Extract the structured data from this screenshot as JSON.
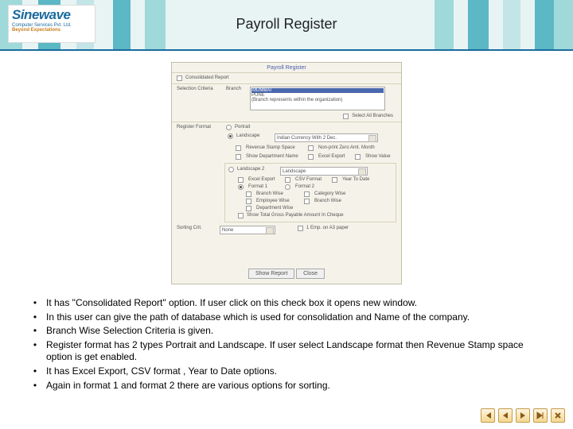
{
  "logo": {
    "name": "Sinewave",
    "line1": "Computer Services Pvt. Ltd.",
    "line2": "Beyond Expectations"
  },
  "title": "Payroll Register",
  "screenshot": {
    "heading": "Payroll Register",
    "consolidated": "Consolidated Report",
    "selection_label": "Selection Criteria",
    "branch_label": "Branch",
    "branch_sel": "MUMBAI",
    "branch_opt1": "PUNE",
    "branch_opt2": "(Branch represents within the organization)",
    "select_all": "Select All Branches",
    "register_label": "Register Format",
    "portrait": "Portrait",
    "landscape_rd": "Landscape",
    "landscape_combo": "Indian Currency With 2 Dec.",
    "revenue": "Revenue Stamp Space",
    "nonprint": "Non-print Zero Amt. Month",
    "show_dept": "Show Department Name",
    "excel_export": "Excel Export",
    "show_value": "Show Value",
    "landscape2": "Landscape 2",
    "landscape_cb": "Landscape",
    "ex_export": "Excel Export",
    "csv": "CSV Format",
    "format1": "Format 1",
    "format2": "Format 2",
    "branch_wise": "Branch Wise",
    "category": "Category Wise",
    "employee_wise": "Employee Wise",
    "branch_wise2": "Branch Wise",
    "department": "Department Wise",
    "show_total": "Show Total Gross Payable Amount In Cheque",
    "sorting_label": "Sorting Crit.",
    "sorting_value": "None",
    "one_page": "1 Emp. on A3 paper",
    "show_report": "Show Report",
    "close": "Close"
  },
  "bullets": [
    "It has \"Consolidated Report\" option. If user click on this check box it opens new window.",
    "In this user can give the path of database which is used for consolidation and Name of the company.",
    "Branch Wise Selection Criteria is given.",
    "Register format has 2 types Portrait and Landscape. If user select Landscape format then Revenue Stamp space option is get enabled.",
    "It has Excel Export, CSV format , Year to Date options.",
    "Again in format 1 and format  2 there are various options for sorting."
  ]
}
